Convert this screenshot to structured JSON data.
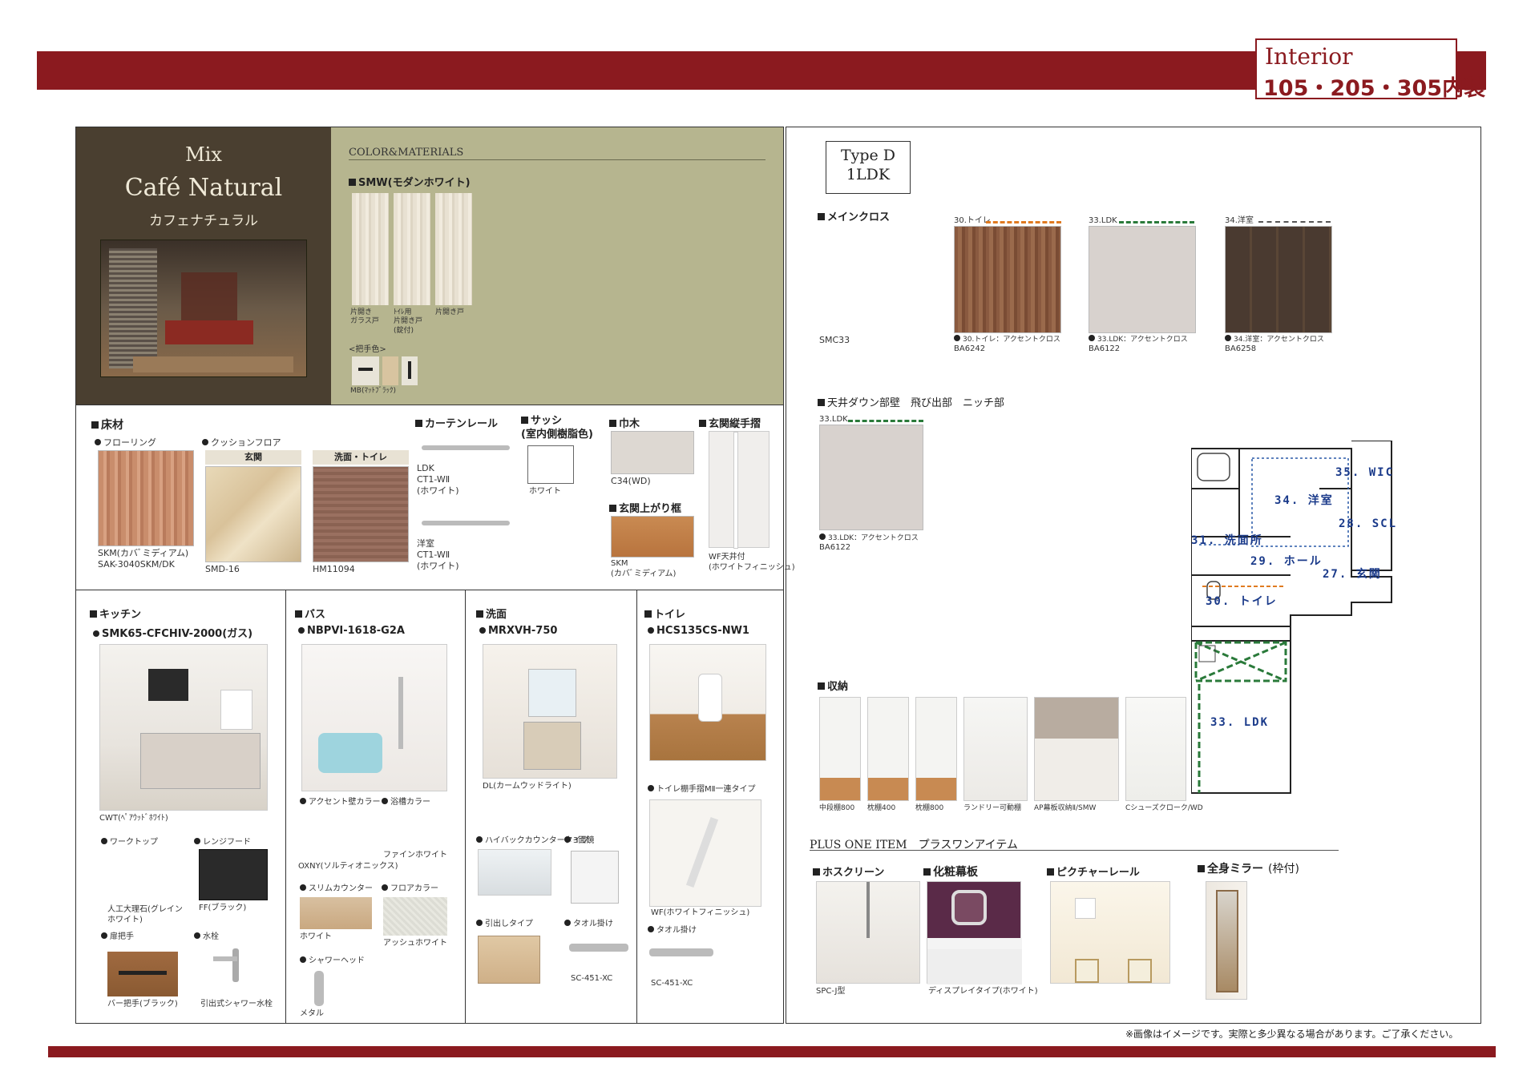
{
  "header": {
    "title_en": "Interior",
    "title_jp": "105・205・305内装"
  },
  "concept": {
    "mix": "Mix",
    "name": "Café Natural",
    "name_jp": "カフェナチュラル"
  },
  "materials": {
    "heading": "COLOR&MATERIALS",
    "door_heading": "SMW(モダンホワイト)",
    "doors": [
      "片開き\nガラス戸",
      "ﾄｲﾚ用\n片開き戸\n(錠付)",
      "片開き戸"
    ],
    "handle_heading": "<把手色>",
    "handle_label": "MB(ﾏｯﾄﾌﾞﾗｯｸ)"
  },
  "floor": {
    "heading": "床材",
    "flooring_label": "フローリング",
    "flooring_code": "SKM(カバﾞミディアム)\nSAK-3040SKM/DK",
    "cushion_label": "クッションフロア",
    "genkan_tag": "玄関",
    "genkan_code": "SMD-16",
    "toilet_tag": "洗面・トイレ",
    "toilet_code": "HM11094"
  },
  "curtain": {
    "heading": "カーテンレール",
    "ldk": "LDK\nCT1-WⅡ\n(ホワイト)",
    "youshitsu": "洋室\nCT1-WⅡ\n(ホワイト)"
  },
  "sash": {
    "heading": "サッシ\n(室内側樹脂色)",
    "color": "ホワイト"
  },
  "habaki": {
    "heading": "巾木",
    "code": "C34(WD)"
  },
  "agarikamachi": {
    "heading": "玄関上がり框",
    "code": "SKM\n(カバﾞミディアム)"
  },
  "handrail": {
    "heading": "玄関縦手摺",
    "code": "WF天井付\n(ホワイトフィニッシュ)"
  },
  "kitchen": {
    "heading": "キッチン",
    "model": "SMK65-CFCHIV-2000(ガス)",
    "color": "CWT(ﾍﾟｱｳｯﾄﾞﾎﾜｲﾄ)",
    "worktop_label": "ワークトップ",
    "worktop_value": "人工大理石(グレイン\nホワイト)",
    "hood_label": "レンジフード",
    "hood_value": "FF(ブラック)",
    "handle_label": "扉把手",
    "handle_value": "バー把手(ブラック)",
    "faucet_label": "水栓",
    "faucet_value": "引出式シャワー水栓"
  },
  "bath": {
    "heading": "バス",
    "model": "NBPVI-1618-G2A",
    "accent_label": "アクセント壁カラー",
    "accent_value": "OXNY(ソルティオニックス)",
    "tub_label": "浴槽カラー",
    "tub_value": "ファインホワイト",
    "counter_label": "スリムカウンター",
    "counter_value": "ホワイト",
    "floor_label": "フロアカラー",
    "floor_value": "アッシュホワイト",
    "shower_label": "シャワーヘッド",
    "shower_value": "メタル"
  },
  "washroom": {
    "heading": "洗面",
    "model": "MRXVH-750",
    "color": "DL(カームウッドライト)",
    "counter_label": "ハイバックカウンタータイプ",
    "mirror_label": "3面鏡",
    "drawer_label": "引出しタイプ",
    "towel_label": "タオル掛け",
    "towel_code": "SC-451-XC"
  },
  "toilet": {
    "heading": "トイレ",
    "model": "HCS135CS-NW1",
    "shelf_label": "トイレ棚手摺MⅡ一連タイプ",
    "shelf_value": "WF(ホワイトフィニッシュ)",
    "towel_label": "タオル掛け",
    "towel_code": "SC-451-XC"
  },
  "typeplan": {
    "type": "Type D",
    "layout": "1LDK",
    "main_cloth_heading": "メインクロス",
    "main_cloth_code": "SMC33",
    "accents": [
      {
        "room": "30.トイレ",
        "label": "30.トイレ：アクセントクロス",
        "code": "BA6242"
      },
      {
        "room": "33.LDK",
        "label": "33.LDK：アクセントクロス",
        "code": "BA6122"
      },
      {
        "room": "34.洋室",
        "label": "34.洋室：アクセントクロス",
        "code": "BA6258"
      }
    ],
    "ceiling_heading": "天井ダウン部壁　飛び出部　ニッチ部",
    "ceiling_room": "33.LDK",
    "ceiling_label": "33.LDK：アクセントクロス",
    "ceiling_code": "BA6122"
  },
  "floorplan": {
    "rooms": [
      "35. WIC",
      "34. 洋室",
      "28. SCL",
      "31. 洗面所",
      "29. ホール",
      "27. 玄関",
      "30. トイレ",
      "33. LDK"
    ]
  },
  "storage": {
    "heading": "収納",
    "items": [
      "中段棚800",
      "枕棚400",
      "枕棚800",
      "ランドリー可動棚",
      "AP幕板収納Ⅱ/SMW",
      "Cシューズクローク/WD"
    ]
  },
  "plus": {
    "heading": "PLUS ONE ITEM　プラスワンアイテム",
    "items": [
      {
        "name": "ホスクリーン",
        "value": "SPC-J型"
      },
      {
        "name": "化粧幕板",
        "value": "ディスプレイタイプ(ホワイト)"
      },
      {
        "name": "ピクチャーレール",
        "value": ""
      },
      {
        "name": "全身ミラー",
        "value": "(枠付)"
      }
    ]
  },
  "footnote": "※画像はイメージです。実際と多少異なる場合があります。ご了承ください。",
  "colors": {
    "accent": "#8b1a1f",
    "concept_bg": "#4a3f30",
    "materials_bg": "#b6b58f"
  }
}
